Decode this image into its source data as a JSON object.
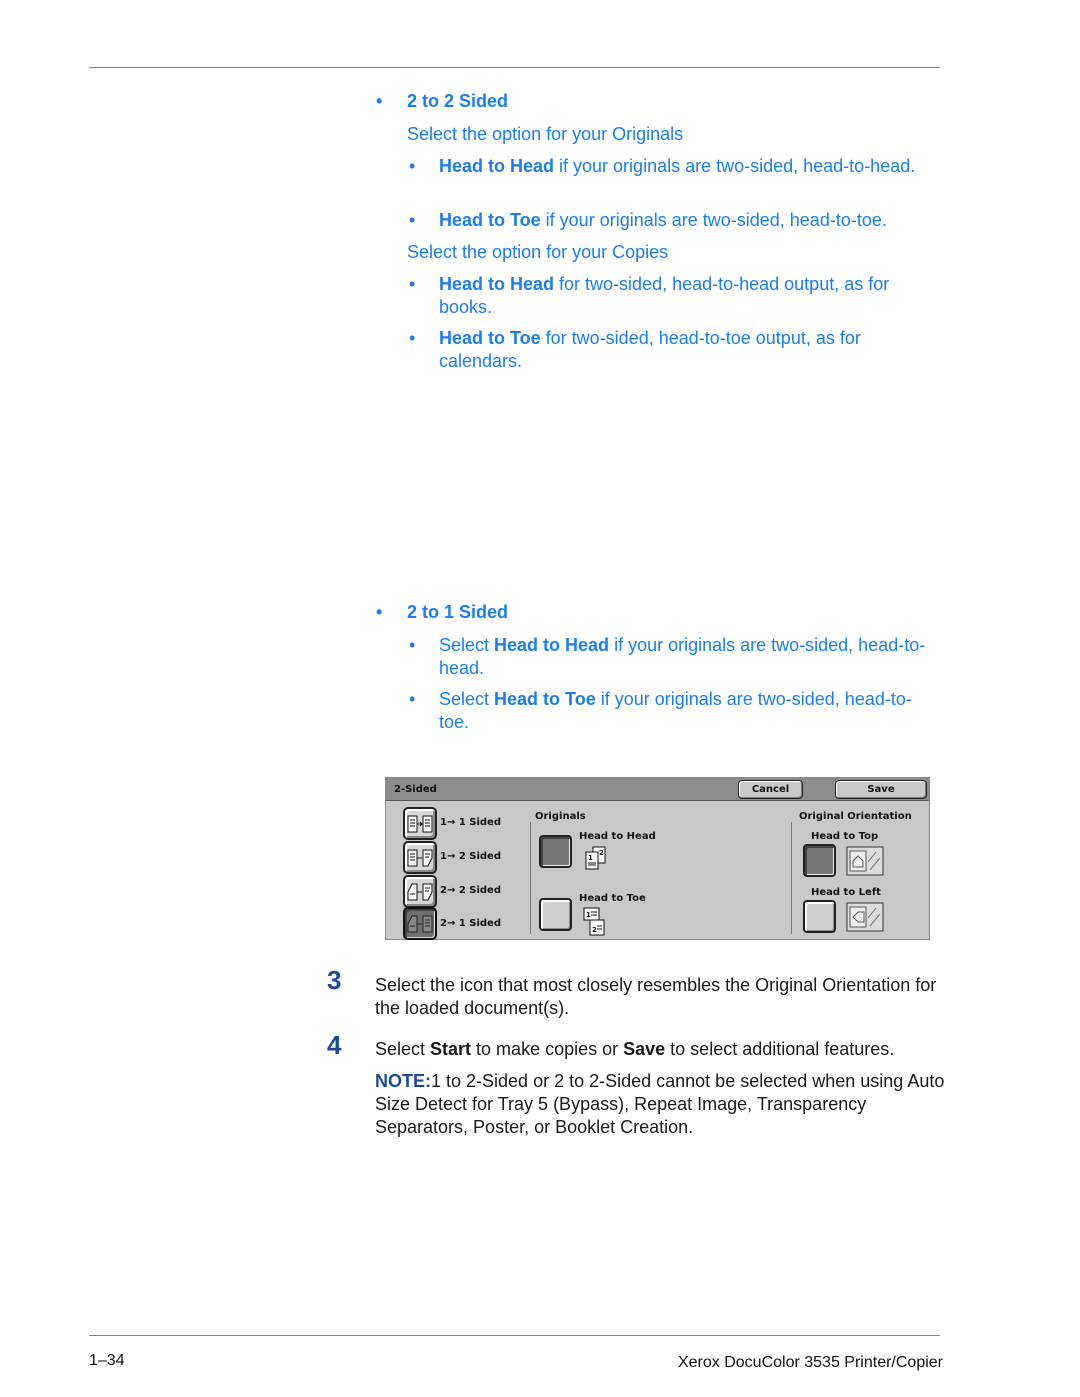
{
  "section_2to2": {
    "heading": "2 to 2 Sided",
    "originals_prompt": "Select the option for your Originals",
    "originals_options": [
      {
        "bold": "Head to Head",
        "rest": " if your originals are two-sided, head-to-head."
      },
      {
        "bold": "Head to Toe",
        "rest": " if your originals are two-sided, head-to-toe."
      }
    ],
    "copies_prompt": "Select the option for your Copies",
    "copies_options": [
      {
        "bold": "Head to Head",
        "rest": " for two-sided, head-to-head output, as for books."
      },
      {
        "bold": "Head to Toe",
        "rest": " for two-sided, head-to-toe output, as for calendars."
      }
    ]
  },
  "section_2to1": {
    "heading": "2 to 1 Sided",
    "options": [
      {
        "pre": "Select ",
        "bold": "Head to Head",
        "rest": " if your originals are two-sided, head-to-head."
      },
      {
        "pre": "Select ",
        "bold": "Head to Toe",
        "rest": " if your originals are two-sided, head-to-toe."
      }
    ]
  },
  "panel": {
    "title": "2-Sided",
    "cancel_label": "Cancel",
    "save_label": "Save",
    "sided_options": [
      {
        "label": "1→ 1 Sided",
        "selected": false
      },
      {
        "label": "1→ 2 Sided",
        "selected": false
      },
      {
        "label": "2→ 2 Sided",
        "selected": false
      },
      {
        "label": "2→ 1 Sided",
        "selected": true
      }
    ],
    "originals": {
      "label": "Originals",
      "options": [
        {
          "label": "Head to Head",
          "selected": true
        },
        {
          "label": "Head to Toe",
          "selected": false
        }
      ]
    },
    "orientation": {
      "label": "Original Orientation",
      "options": [
        {
          "label": "Head to Top",
          "selected": true
        },
        {
          "label": "Head to Left",
          "selected": false
        }
      ]
    }
  },
  "steps": [
    {
      "number": "3",
      "text": "Select the icon that most closely resembles the Original Orientation for the loaded document(s)."
    },
    {
      "number": "4",
      "pre": "Select ",
      "bold1": "Start",
      "mid": " to make copies or ",
      "bold2": "Save",
      "post": " to select additional features."
    }
  ],
  "note": {
    "label": "NOTE:",
    "text": "1 to 2-Sided or 2 to 2-Sided cannot be selected when using Auto Size Detect for Tray 5 (Bypass), Repeat Image, Transparency Separators, Poster, or Booklet Creation."
  },
  "footer": {
    "page_number": "1–34",
    "product": "Xerox DocuColor 3535 Printer/Copier"
  }
}
